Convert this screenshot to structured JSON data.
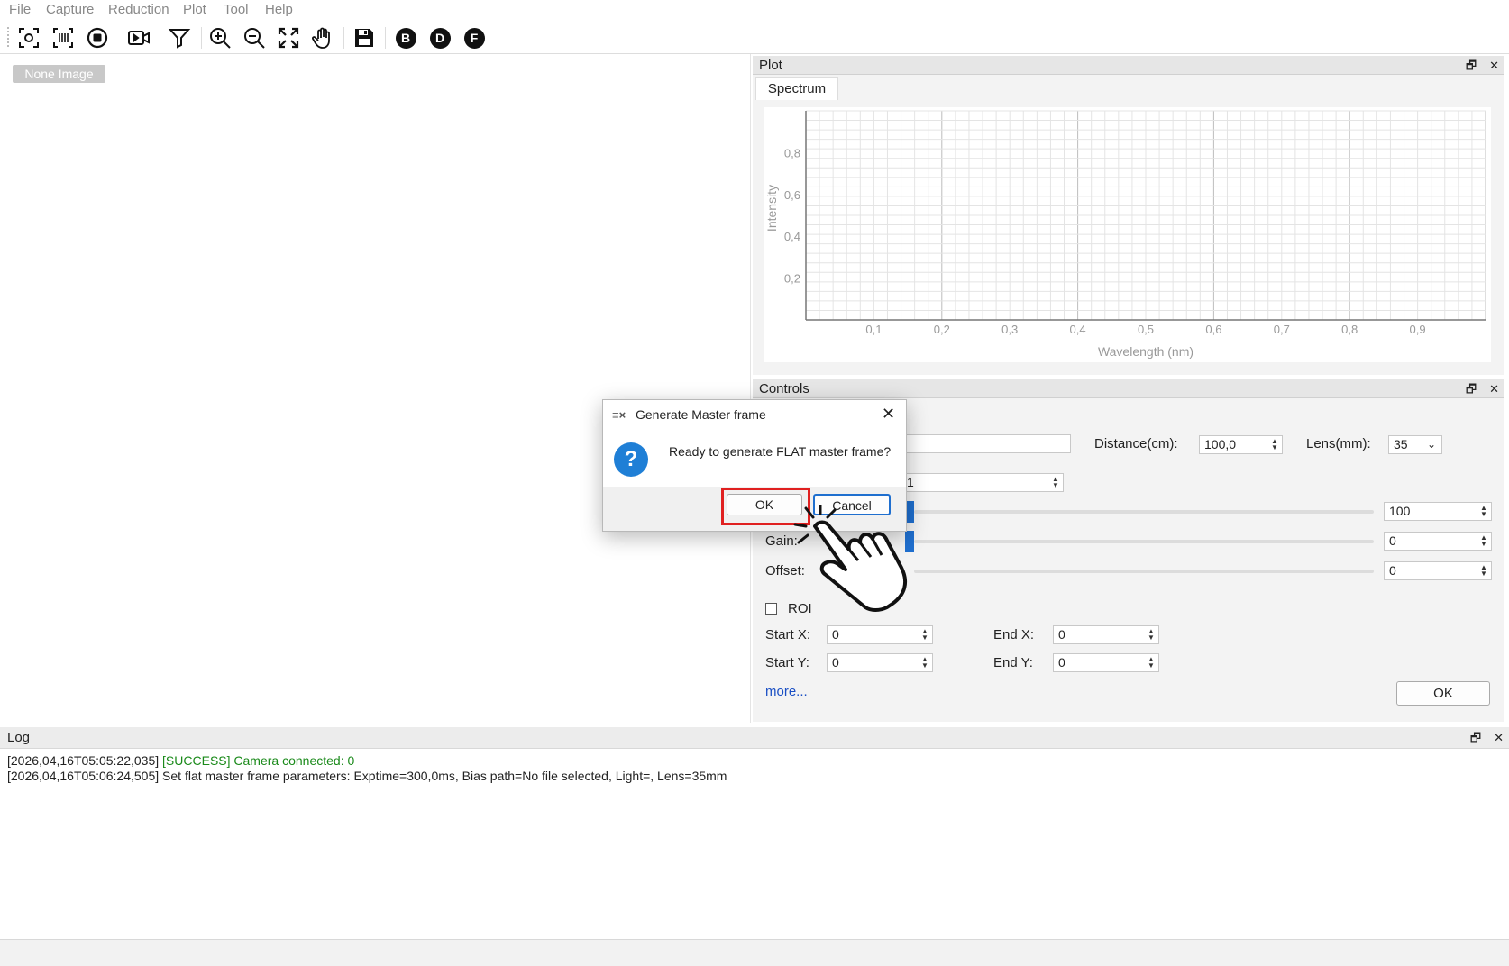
{
  "menu": [
    "File",
    "Capture",
    "Reduction",
    "Plot",
    "Tool",
    "Help"
  ],
  "toolbar": {
    "letters": [
      "B",
      "D",
      "F"
    ]
  },
  "image_area": {
    "badge": "None Image"
  },
  "plot_panel": {
    "title": "Plot",
    "tab": "Spectrum"
  },
  "chart_data": {
    "type": "line",
    "xlabel": "Wavelength (nm)",
    "ylabel": "Intensity",
    "x_ticks": [
      "0,1",
      "0,2",
      "0,3",
      "0,4",
      "0,5",
      "0,6",
      "0,7",
      "0,8",
      "0,9"
    ],
    "y_ticks": [
      "0,2",
      "0,4",
      "0,6",
      "0,8"
    ],
    "xlim": [
      0,
      1
    ],
    "ylim": [
      0,
      1
    ],
    "series": [],
    "grid": true
  },
  "controls": {
    "title": "Controls",
    "distance_label": "Distance(cm):",
    "distance_value": "100,0",
    "lens_label": "Lens(mm):",
    "lens_value": "35",
    "field2_value": "1",
    "slider1_value": "100",
    "gain_label": "Gain:",
    "gain_value": "0",
    "offset_label": "Offset:",
    "offset_value": "0",
    "roi_label": "ROI",
    "start_x_label": "Start X:",
    "start_x": "0",
    "end_x_label": "End X:",
    "end_x": "0",
    "start_y_label": "Start Y:",
    "start_y": "0",
    "end_y_label": "End Y:",
    "end_y": "0",
    "more_link": "more...",
    "ok_label": "OK"
  },
  "log": {
    "title": "Log",
    "lines": [
      {
        "timestamp": "[2026,04,16T05:05:22,035]",
        "level": "[SUCCESS]",
        "message": "Camera connected: 0"
      },
      {
        "timestamp": "[2026,04,16T05:06:24,505]",
        "message": "Set flat master frame parameters: Exptime=300,0ms, Bias path=No file selected, Light=, Lens=35mm"
      }
    ]
  },
  "dialog": {
    "title": "Generate Master frame",
    "message": "Ready to generate FLAT master frame?",
    "ok_label": "OK",
    "cancel_label": "Cancel",
    "icon_glyph": "?"
  },
  "colors": {
    "accent": "#1f6fcf",
    "highlight": "#e02020",
    "success": "#1a8a1a"
  }
}
